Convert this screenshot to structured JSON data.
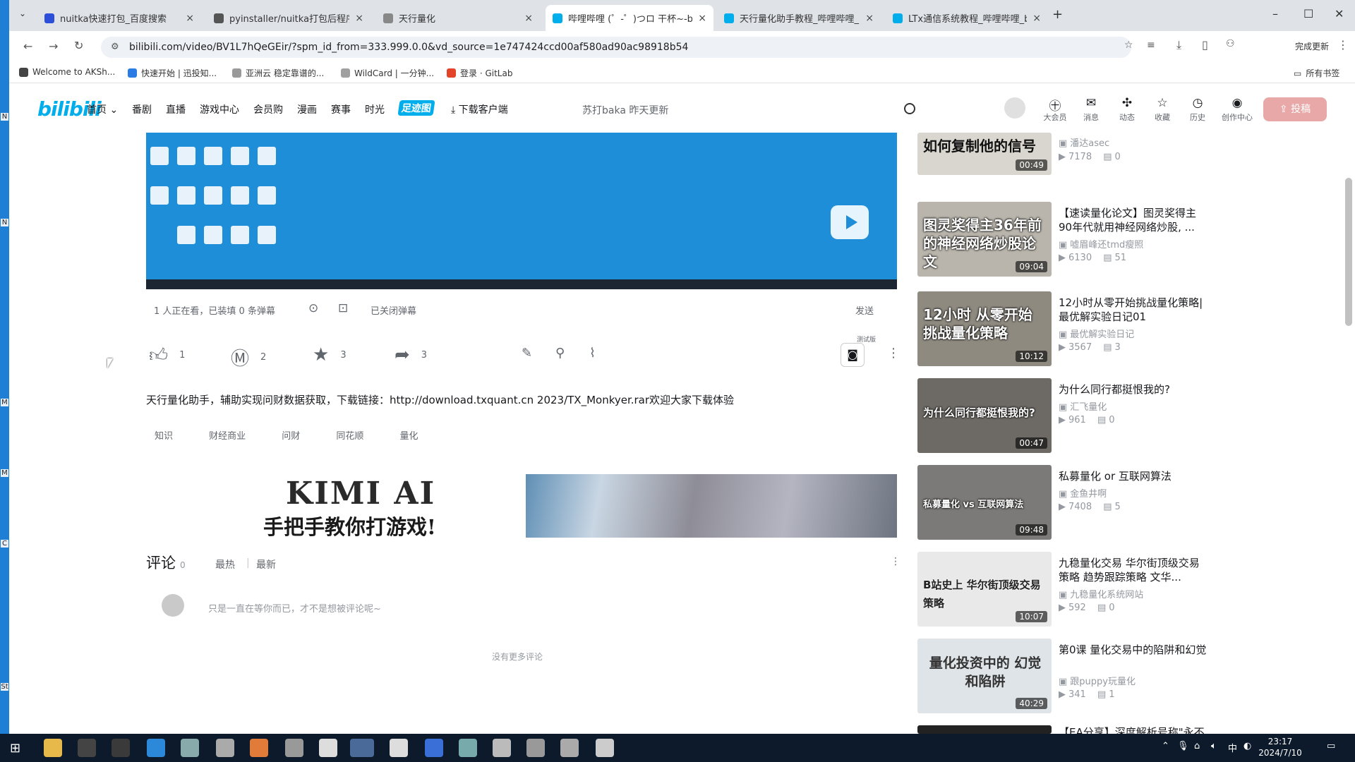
{
  "browser": {
    "tabs": [
      {
        "title": "nuitka快速打包_百度搜索",
        "color": "#2b4fd9"
      },
      {
        "title": "pyinstaller/nuitka打包后程序",
        "color": "#555555"
      },
      {
        "title": "天行量化",
        "color": "#888888"
      },
      {
        "title": "哔哩哔哩 (゜-゜)つロ 干杯~-bi",
        "color": "#00aeec"
      },
      {
        "title": "天行量化助手教程_哔哩哔哩_b",
        "color": "#00aeec"
      },
      {
        "title": "LTx通信系统教程_哔哩哔哩_bi",
        "color": "#00aeec"
      }
    ],
    "new_tab": "+",
    "url": "bilibili.com/video/BV1L7hQeGEir/?spm_id_from=333.999.0.0&vd_source=1e747424ccd00af580ad90ac98918b54",
    "update_label": "完成更新",
    "bookmarks": [
      {
        "label": "Welcome to AKSh...",
        "color": "#444444"
      },
      {
        "label": "快速开始 | 迅投知...",
        "color": "#2a7be4"
      },
      {
        "label": "亚洲云 稳定靠谱的...",
        "color": "#9a9a9a"
      },
      {
        "label": "WildCard | 一分钟...",
        "color": "#a0a0a0"
      },
      {
        "label": "登录 · GitLab",
        "color": "#e24329"
      }
    ],
    "all_bookmarks": "所有书签"
  },
  "bili_header": {
    "logo": "bilibili",
    "nav": [
      "首页",
      "番剧",
      "直播",
      "游戏中心",
      "会员购",
      "漫画",
      "赛事",
      "时光",
      "足迹图",
      "下载客户端"
    ],
    "search_placeholder": "苏打baka 昨天更新",
    "icons": [
      {
        "label": "大会员",
        "glyph": "㊉"
      },
      {
        "label": "消息",
        "glyph": "✉"
      },
      {
        "label": "动态",
        "glyph": "✣"
      },
      {
        "label": "收藏",
        "glyph": "☆"
      },
      {
        "label": "历史",
        "glyph": "◷"
      },
      {
        "label": "创作中心",
        "glyph": "◉"
      }
    ],
    "upload": "投稿"
  },
  "player": {
    "viewers": "1 人正在看，已装填 0 条弹幕",
    "danmaku_closed": "已关闭弹幕",
    "send": "发送",
    "test_label": "测试版"
  },
  "actions": {
    "like": "1",
    "coin": "2",
    "favorite": "3",
    "share": "3"
  },
  "description": "天行量化助手，辅助实现问财数据获取，下载链接：http://download.txquant.cn 2023/TX_Monkyer.rar欢迎大家下载体验",
  "tags": [
    "知识",
    "财经商业",
    "问财",
    "同花顺",
    "量化"
  ],
  "banner": {
    "title": "KIMI AI",
    "subtitle": "手把手教你打游戏!"
  },
  "comments": {
    "title": "评论",
    "count": "0",
    "sort_hot": "最热",
    "sort_new": "最新",
    "placeholder": "只是一直在等你而已，才不是想被评论呢~",
    "no_more": "没有更多评论"
  },
  "recommendations": [
    {
      "title": "",
      "up": "潘达asec",
      "views": "7178",
      "danmaku": "0",
      "duration": "00:49",
      "caption": "如何复制他的信号",
      "bg": "#d9d6cf"
    },
    {
      "title": "【速读量化论文】图灵奖得主90年代就用神经网络炒股, ...",
      "up": "嘘眉峰还tmd瘦照",
      "views": "6130",
      "danmaku": "51",
      "duration": "09:04",
      "caption": "图灵奖得主36年前的神经网络炒股论文",
      "bg": "#b9b5ac"
    },
    {
      "title": "12小时从零开始挑战量化策略|最优解实验日记01",
      "up": "最优解实验日记",
      "views": "3567",
      "danmaku": "3",
      "duration": "10:12",
      "caption": "12小时 从零开始 挑战量化策略",
      "bg": "#8f8a80"
    },
    {
      "title": "为什么同行都挺恨我的?",
      "up": "汇飞量化",
      "views": "961",
      "danmaku": "0",
      "duration": "00:47",
      "caption": "为什么同行都挺恨我的?",
      "bg": "#6d6a65"
    },
    {
      "title": "私募量化 or 互联网算法",
      "up": "金鱼井啊",
      "views": "7408",
      "danmaku": "5",
      "duration": "09:48",
      "caption": "私募量化 vs 互联网算法",
      "bg": "#7b7a78"
    },
    {
      "title": "九稳量化交易 华尔街顶级交易策略 趋势跟踪策略 文华...",
      "up": "九稳量化系统网站",
      "views": "592",
      "danmaku": "0",
      "duration": "10:07",
      "caption": "B站史上 华尔街顶级交易策略",
      "bg": "#e9e9e9"
    },
    {
      "title": "第0课 量化交易中的陷阱和幻觉",
      "up": "跟puppy玩量化",
      "views": "341",
      "danmaku": "1",
      "duration": "40:29",
      "caption": "量化投资中的 幻觉和陷阱",
      "bg": "#dfe4e8"
    },
    {
      "title": "【EA分享】深度解析号称\"永不",
      "up": "",
      "views": "",
      "danmaku": "",
      "duration": "",
      "caption": "",
      "bg": "#222222"
    }
  ],
  "left_strip": [
    "N",
    "N",
    "M",
    "M",
    "C",
    "St"
  ],
  "taskbar": {
    "time": "23:17",
    "date": "2024/7/10",
    "ime": "中"
  }
}
